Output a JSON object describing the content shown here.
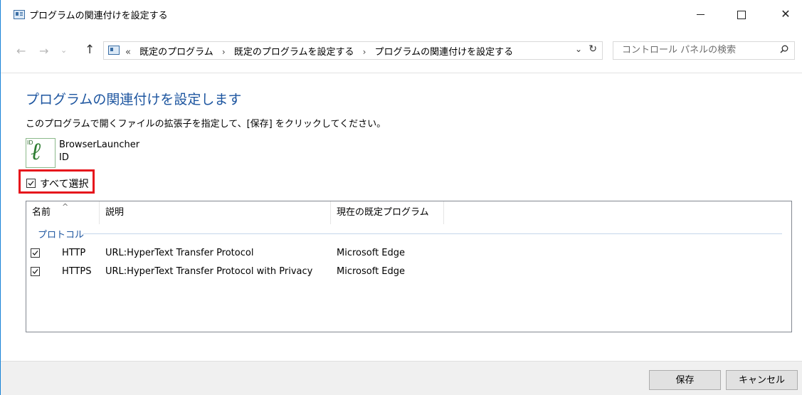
{
  "window": {
    "title": "プログラムの関連付けを設定する",
    "controls": {
      "minimize": "",
      "maximize": "",
      "close": "✕"
    }
  },
  "nav": {
    "back": "←",
    "forward": "→",
    "recent": "⌄",
    "up": "↑",
    "breadcrumbs_prefix": "«",
    "breadcrumbs": [
      "既定のプログラム",
      "既定のプログラムを設定する",
      "プログラムの関連付けを設定する"
    ],
    "separator": "›",
    "dropdown": "⌄",
    "refresh": "↻",
    "search_placeholder": "コントロール パネルの検索"
  },
  "main": {
    "heading": "プログラムの関連付けを設定します",
    "instruction": "このプログラムで開くファイルの拡張子を指定して、[保存] をクリックしてください。",
    "program": {
      "name": "BrowserLauncher",
      "id": "ID",
      "icon_tag": "ID",
      "icon_glyph": "ℓ"
    },
    "select_all": {
      "label": "すべて選択",
      "checked": true
    }
  },
  "list": {
    "sort_caret": "^",
    "columns": [
      "名前",
      "説明",
      "現在の既定プログラム"
    ],
    "group": "プロトコル",
    "rows": [
      {
        "checked": true,
        "name": "HTTP",
        "description": "URL:HyperText Transfer Protocol",
        "current_default": "Microsoft Edge"
      },
      {
        "checked": true,
        "name": "HTTPS",
        "description": "URL:HyperText Transfer Protocol with Privacy",
        "current_default": "Microsoft Edge"
      }
    ]
  },
  "footer": {
    "save": "保存",
    "cancel": "キャンセル"
  },
  "colors": {
    "accent": "#1e56a0",
    "highlight": "#e6151c",
    "border": "#1883d7"
  }
}
